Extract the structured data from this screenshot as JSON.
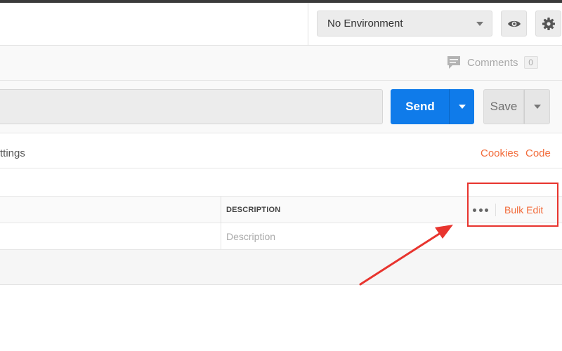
{
  "environment": {
    "selected": "No Environment"
  },
  "header_icons": {
    "view": "eye-icon",
    "settings": "gear-icon"
  },
  "comments": {
    "label": "Comments",
    "count": "0",
    "icon": "comment-icon"
  },
  "request": {
    "url_value": "",
    "send_label": "Send",
    "save_label": "Save"
  },
  "tabs": {
    "settings_partial": "ttings",
    "cookies_link": "Cookies",
    "code_link": "Code"
  },
  "params_table": {
    "header_description": "DESCRIPTION",
    "bulk_edit_label": "Bulk Edit",
    "more_icon": "more-dots-icon",
    "description_placeholder": "Description"
  },
  "colors": {
    "accent_orange": "#f26b3a",
    "send_blue": "#0f7bea",
    "annotation_red": "#e8342e"
  }
}
